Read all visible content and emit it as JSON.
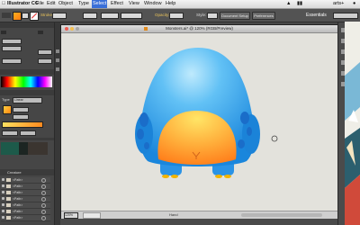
{
  "menubar": {
    "app_name": "Illustrator CC",
    "items": [
      "File",
      "Edit",
      "Object",
      "Type",
      "Select",
      "Effect",
      "View",
      "Window",
      "Help"
    ],
    "selected_item": "Select",
    "status_text": "arts+"
  },
  "controlbar": {
    "stroke_label": "Stroke:",
    "opacity_label": "Opacity:",
    "style_label": "Style:",
    "document_setup_label": "Document Setup",
    "preferences_label": "Preferences",
    "workspace_label": "Essentials"
  },
  "colors": {
    "monster_body_top": "#7fd4f7",
    "monster_body_bottom": "#1e8fe0",
    "monster_belly_top": "#ffd85a",
    "monster_belly_bottom": "#ff8a1e",
    "spot": "#1a6dc9",
    "artboard": "#e3e2dc"
  },
  "leftpanel": {
    "type_label": "Type",
    "type_value": "Linear",
    "layers_tab_label": "Creature",
    "layer_rows": [
      "<Path>",
      "<Path>",
      "<Path>",
      "<Path>",
      "<Path>",
      "<Path>",
      "<Path>"
    ]
  },
  "document": {
    "title": "Monsters.ai* @ 120% (RGB/Preview)",
    "zoom": "120%",
    "status_label": "Hand"
  }
}
